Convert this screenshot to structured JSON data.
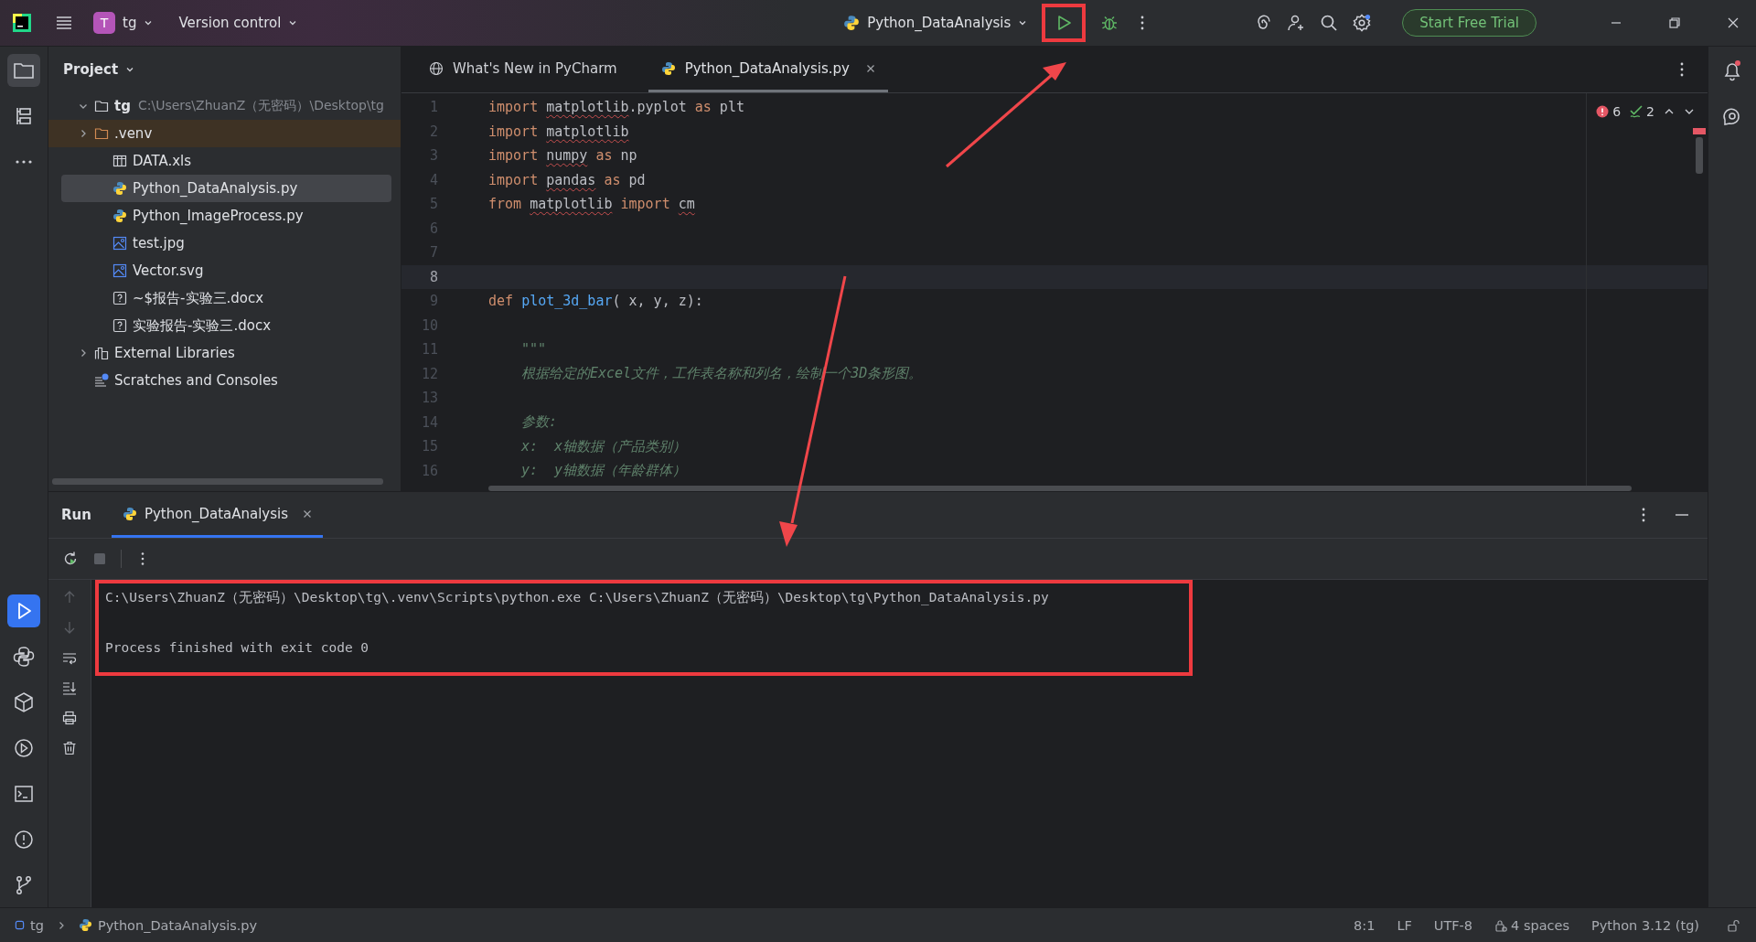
{
  "title_bar": {
    "project_initial": "T",
    "project": "tg",
    "vcs": "Version control",
    "run_config": "Python_DataAnalysis",
    "trial_button": "Start Free Trial"
  },
  "project_panel": {
    "title": "Project",
    "tree": [
      {
        "label": "tg",
        "path": "C:\\Users\\ZhuanZ（无密码）\\Desktop\\tg",
        "kind": "folder",
        "expanded": true,
        "selected": false,
        "highlighted": false,
        "children": [
          {
            "label": ".venv",
            "kind": "venv",
            "expanded": false,
            "selected": false,
            "highlighted": true
          },
          {
            "label": "DATA.xls",
            "kind": "table",
            "selected": false,
            "highlighted": false
          },
          {
            "label": "Python_DataAnalysis.py",
            "kind": "python",
            "selected": true,
            "highlighted": false
          },
          {
            "label": "Python_ImageProcess.py",
            "kind": "python",
            "selected": false,
            "highlighted": false
          },
          {
            "label": "test.jpg",
            "kind": "image",
            "selected": false,
            "highlighted": false
          },
          {
            "label": "Vector.svg",
            "kind": "image",
            "selected": false,
            "highlighted": false
          },
          {
            "label": "~$报告-实验三.docx",
            "kind": "unknown",
            "selected": false,
            "highlighted": false
          },
          {
            "label": "实验报告-实验三.docx",
            "kind": "unknown",
            "selected": false,
            "highlighted": false
          }
        ]
      },
      {
        "label": "External Libraries",
        "kind": "library",
        "expanded": false,
        "selected": false,
        "highlighted": false
      },
      {
        "label": "Scratches and Consoles",
        "kind": "scratch",
        "selected": false,
        "highlighted": false
      }
    ]
  },
  "editor_tabs": [
    {
      "label": "What's New in PyCharm",
      "kind": "web",
      "selected": false,
      "closable": false
    },
    {
      "label": "Python_DataAnalysis.py",
      "kind": "python",
      "selected": true,
      "closable": true
    }
  ],
  "inspections": {
    "errors": "6",
    "warnings": "2"
  },
  "code_lines": [
    {
      "number": "1",
      "current": false,
      "tokens": [
        {
          "text": "import ",
          "kind": "keyword"
        },
        {
          "text": "matplotlib",
          "kind": "warn"
        },
        {
          "text": ".pyplot ",
          "kind": "plain"
        },
        {
          "text": "as",
          "kind": "keyword"
        },
        {
          "text": " plt",
          "kind": "plain"
        }
      ]
    },
    {
      "number": "2",
      "current": false,
      "tokens": [
        {
          "text": "import ",
          "kind": "keyword"
        },
        {
          "text": "matplotlib",
          "kind": "warn"
        }
      ]
    },
    {
      "number": "3",
      "current": false,
      "tokens": [
        {
          "text": "import ",
          "kind": "keyword"
        },
        {
          "text": "numpy",
          "kind": "warn"
        },
        {
          "text": " as",
          "kind": "keyword"
        },
        {
          "text": " np",
          "kind": "plain"
        }
      ]
    },
    {
      "number": "4",
      "current": false,
      "tokens": [
        {
          "text": "import ",
          "kind": "keyword"
        },
        {
          "text": "pandas",
          "kind": "warn"
        },
        {
          "text": " as",
          "kind": "keyword"
        },
        {
          "text": " pd",
          "kind": "plain"
        }
      ]
    },
    {
      "number": "5",
      "current": false,
      "tokens": [
        {
          "text": "from ",
          "kind": "keyword"
        },
        {
          "text": "matplotlib",
          "kind": "warn"
        },
        {
          "text": " import ",
          "kind": "keyword"
        },
        {
          "text": "cm",
          "kind": "warn"
        }
      ]
    },
    {
      "number": "6",
      "current": false
    },
    {
      "number": "7",
      "current": false
    },
    {
      "number": "8",
      "current": true
    },
    {
      "number": "9",
      "current": false,
      "tokens": [
        {
          "text": "def ",
          "kind": "keyword"
        },
        {
          "text": "plot_3d_bar",
          "kind": "func"
        },
        {
          "text": "( x, y, z):",
          "kind": "plain"
        }
      ]
    },
    {
      "number": "10",
      "current": false
    },
    {
      "number": "11",
      "current": false,
      "tokens": [
        {
          "text": "\"\"\"",
          "kind": "doc"
        }
      ]
    },
    {
      "number": "12",
      "current": false,
      "tokens": [
        {
          "text": "根据给定的Excel文件，工作表名称和列名，绘制一个3D条形图。",
          "kind": "doc"
        }
      ]
    },
    {
      "number": "13",
      "current": false
    },
    {
      "number": "14",
      "current": false,
      "tokens": [
        {
          "text": "参数:",
          "kind": "doc"
        }
      ]
    },
    {
      "number": "15",
      "current": false,
      "tokens": [
        {
          "text": "x:  x轴数据（产品类别）",
          "kind": "doc"
        }
      ]
    },
    {
      "number": "16",
      "current": false,
      "tokens": [
        {
          "text": "y:  y轴数据（年龄群体）",
          "kind": "doc"
        }
      ]
    }
  ],
  "run_panel": {
    "title": "Run",
    "tabs": [
      {
        "label": "Python_DataAnalysis",
        "selected": true
      }
    ],
    "output": [
      "C:\\Users\\ZhuanZ（无密码）\\Desktop\\tg\\.venv\\Scripts\\python.exe C:\\Users\\ZhuanZ（无密码）\\Desktop\\tg\\Python_DataAnalysis.py",
      "Process finished with exit code 0"
    ]
  },
  "status_bar": {
    "breadcrumbs": [
      "tg",
      "Python_DataAnalysis.py"
    ],
    "items": [
      "8:1",
      "LF",
      "UTF-8",
      "4 spaces",
      "Python 3.12 (tg)"
    ]
  }
}
